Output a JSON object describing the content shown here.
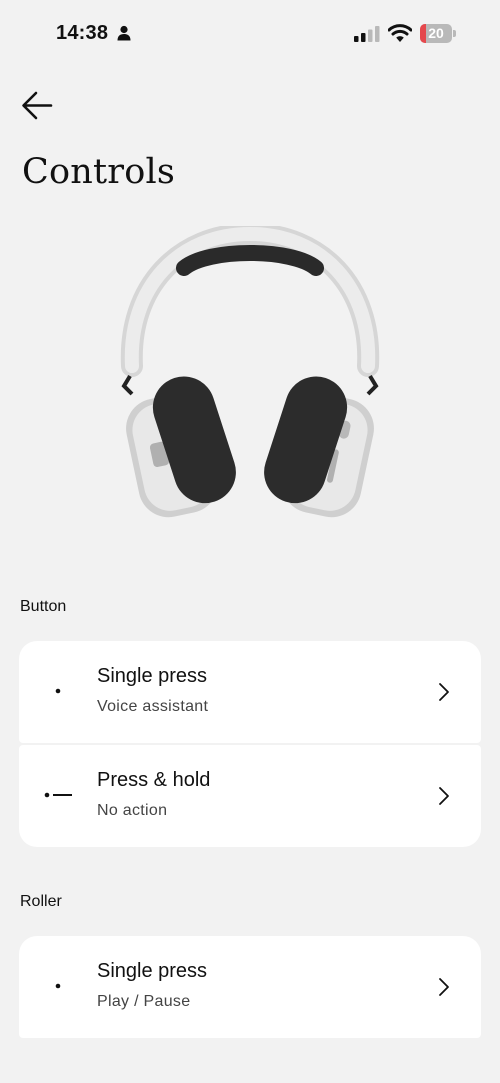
{
  "status_bar": {
    "time": "14:38",
    "battery_level": "20",
    "battery_fraction": 0.2,
    "icons": [
      "person-icon",
      "signal-icon",
      "wifi-icon",
      "battery-icon"
    ]
  },
  "header": {
    "back_icon": "arrow-left-icon",
    "title": "Controls"
  },
  "sections": [
    {
      "label": "Button",
      "items": [
        {
          "icon": "dot-icon",
          "title": "Single press",
          "subtitle": "Voice assistant"
        },
        {
          "icon": "dot-dash-icon",
          "title": "Press & hold",
          "subtitle": "No action"
        }
      ]
    },
    {
      "label": "Roller",
      "items": [
        {
          "icon": "dot-icon",
          "title": "Single press",
          "subtitle": "Play / Pause"
        }
      ]
    }
  ],
  "colors": {
    "background": "#f2f2f2",
    "card": "#ffffff",
    "battery_low": "#e5484d",
    "text": "#111111"
  }
}
